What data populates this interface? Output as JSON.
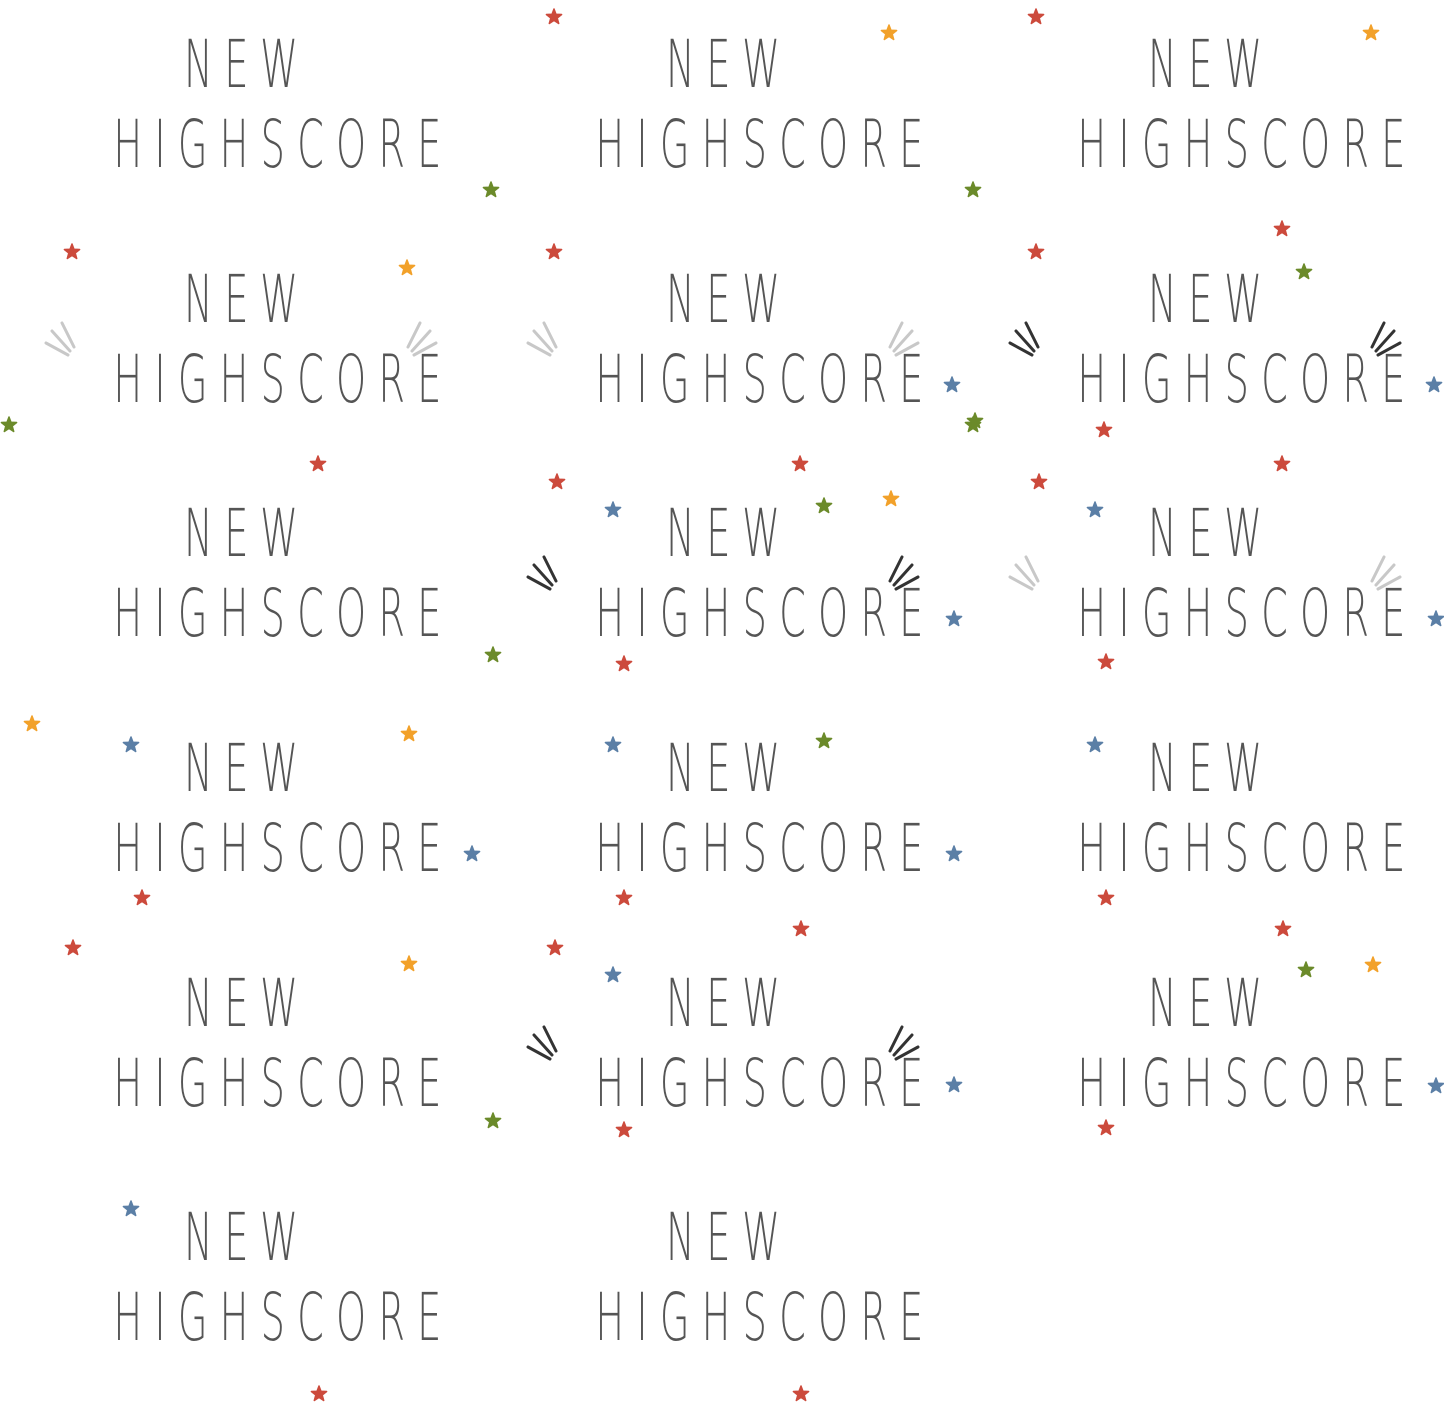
{
  "sprite_sheet": {
    "columns": 3,
    "rows": 6,
    "background": "#ffffff",
    "text_color": "#555555",
    "colors": {
      "red": "#cc4a3c",
      "orange": "#f2a12a",
      "green": "#6b8a2a",
      "blue": "#5b7fa6",
      "burst_dark": "#333333",
      "burst_light": "#c8c8c8"
    },
    "frames": [
      {
        "line1": "NEW",
        "line2": "HIGHSCORE",
        "burst": null,
        "stars": []
      },
      {
        "line1": "NEW",
        "line2": "HIGHSCORE",
        "burst": null,
        "stars": [
          [
            "red",
            72,
            17
          ],
          [
            "orange",
            407,
            33
          ],
          [
            "green",
            9,
            190
          ]
        ]
      },
      {
        "line1": "NEW",
        "line2": "HIGHSCORE",
        "burst": null,
        "stars": [
          [
            "red",
            72,
            17
          ],
          [
            "orange",
            407,
            33
          ],
          [
            "green",
            9,
            190
          ],
          [
            "red",
            318,
            229
          ]
        ]
      },
      {
        "line1": "NEW",
        "line2": "HIGHSCORE",
        "burst": "light",
        "stars": [
          [
            "red",
            72,
            17
          ],
          [
            "orange",
            407,
            33
          ],
          [
            "green",
            9,
            190
          ],
          [
            "red",
            318,
            229
          ]
        ]
      },
      {
        "line1": "NEW",
        "line2": "HIGHSCORE",
        "burst": "light",
        "stars": [
          [
            "red",
            72,
            17
          ],
          [
            "blue",
            470,
            150
          ],
          [
            "green",
            493,
            186
          ],
          [
            "red",
            318,
            229
          ]
        ]
      },
      {
        "line1": "NEW",
        "line2": "HIGHSCORE",
        "burst": "dark",
        "stars": [
          [
            "red",
            72,
            17
          ],
          [
            "green",
            340,
            37
          ],
          [
            "green",
            9,
            190
          ],
          [
            "blue",
            470,
            150
          ],
          [
            "green",
            493,
            186
          ],
          [
            "red",
            140,
            195
          ],
          [
            "red",
            318,
            229
          ]
        ]
      },
      {
        "line1": "NEW",
        "line2": "HIGHSCORE",
        "burst": null,
        "stars": []
      },
      {
        "line1": "NEW",
        "line2": "HIGHSCORE",
        "burst": "dark",
        "stars": [
          [
            "red",
            75,
            13
          ],
          [
            "blue",
            131,
            41
          ],
          [
            "green",
            342,
            37
          ],
          [
            "orange",
            409,
            30
          ],
          [
            "green",
            11,
            186
          ],
          [
            "blue",
            472,
            150
          ],
          [
            "red",
            142,
            195
          ]
        ]
      },
      {
        "line1": "NEW",
        "line2": "HIGHSCORE",
        "burst": "light",
        "stars": [
          [
            "red",
            75,
            13
          ],
          [
            "blue",
            131,
            41
          ],
          [
            "blue",
            472,
            150
          ],
          [
            "red",
            505,
            140
          ],
          [
            "green",
            493,
            186
          ],
          [
            "red",
            142,
            193
          ]
        ]
      },
      {
        "line1": "NEW",
        "line2": "HIGHSCORE",
        "burst": null,
        "stars": [
          [
            "orange",
            32,
            20
          ],
          [
            "blue",
            131,
            41
          ],
          [
            "orange",
            409,
            30
          ],
          [
            "blue",
            472,
            150
          ],
          [
            "red",
            142,
            194
          ]
        ]
      },
      {
        "line1": "NEW",
        "line2": "HIGHSCORE",
        "burst": null,
        "stars": [
          [
            "blue",
            131,
            41
          ],
          [
            "green",
            342,
            37
          ],
          [
            "blue",
            472,
            150
          ],
          [
            "red",
            142,
            194
          ],
          [
            "red",
            319,
            225
          ]
        ]
      },
      {
        "line1": "NEW",
        "line2": "HIGHSCORE",
        "burst": null,
        "stars": [
          [
            "blue",
            131,
            41
          ],
          [
            "red",
            142,
            194
          ],
          [
            "red",
            319,
            225
          ]
        ]
      },
      {
        "line1": "NEW",
        "line2": "HIGHSCORE",
        "burst": null,
        "stars": [
          [
            "red",
            73,
            9
          ],
          [
            "orange",
            409,
            25
          ]
        ]
      },
      {
        "line1": "NEW",
        "line2": "HIGHSCORE",
        "burst": "dark",
        "stars": [
          [
            "red",
            73,
            9
          ],
          [
            "blue",
            131,
            36
          ],
          [
            "green",
            11,
            182
          ],
          [
            "red",
            142,
            191
          ],
          [
            "blue",
            472,
            146
          ]
        ]
      },
      {
        "line1": "NEW",
        "line2": "HIGHSCORE",
        "burst": null,
        "stars": [
          [
            "green",
            342,
            31
          ],
          [
            "orange",
            409,
            26
          ],
          [
            "blue",
            472,
            147
          ],
          [
            "red",
            142,
            189
          ]
        ]
      },
      {
        "line1": "NEW",
        "line2": "HIGHSCORE",
        "burst": null,
        "stars": [
          [
            "blue",
            131,
            36
          ],
          [
            "red",
            319,
            221
          ]
        ]
      },
      {
        "line1": "NEW",
        "line2": "HIGHSCORE",
        "burst": null,
        "stars": [
          [
            "red",
            319,
            221
          ]
        ]
      },
      {
        "line1": "",
        "line2": "",
        "burst": null,
        "stars": []
      }
    ]
  }
}
